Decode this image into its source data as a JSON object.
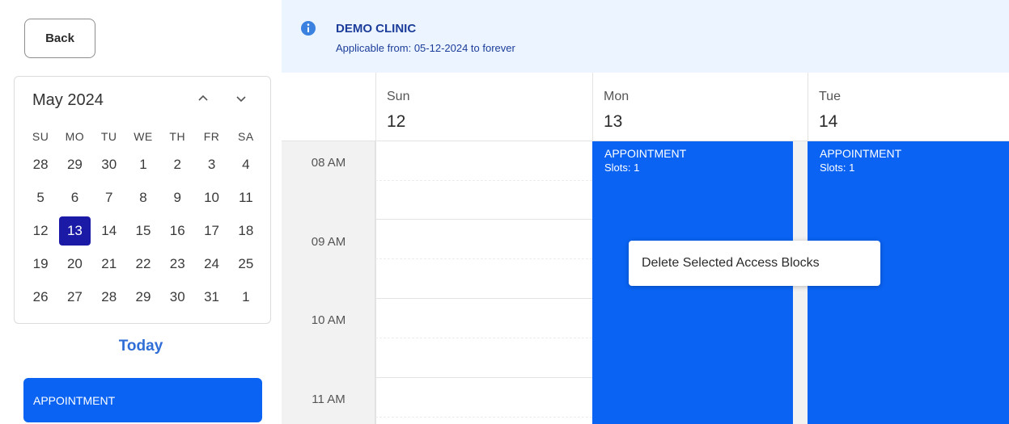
{
  "sidebar": {
    "back_label": "Back",
    "calendar": {
      "month_label": "May 2024",
      "weekday_headers": [
        "SU",
        "MO",
        "TU",
        "WE",
        "TH",
        "FR",
        "SA"
      ],
      "weeks": [
        [
          "28",
          "29",
          "30",
          "1",
          "2",
          "3",
          "4"
        ],
        [
          "5",
          "6",
          "7",
          "8",
          "9",
          "10",
          "11"
        ],
        [
          "12",
          "13",
          "14",
          "15",
          "16",
          "17",
          "18"
        ],
        [
          "19",
          "20",
          "21",
          "22",
          "23",
          "24",
          "25"
        ],
        [
          "26",
          "27",
          "28",
          "29",
          "30",
          "31",
          "1"
        ]
      ],
      "selected_day": "13",
      "prev_icon": "chevron-up-icon",
      "next_icon": "chevron-down-icon"
    },
    "today_label": "Today",
    "appointment_label": "APPOINTMENT"
  },
  "banner": {
    "icon": "info-icon",
    "title": "DEMO CLINIC",
    "subtitle": "Applicable from: 05-12-2024 to forever"
  },
  "schedule": {
    "days": [
      {
        "name": "Sun",
        "number": "12"
      },
      {
        "name": "Mon",
        "number": "13"
      },
      {
        "name": "Tue",
        "number": "14"
      }
    ],
    "times": [
      "08 AM",
      "09 AM",
      "10 AM",
      "11 AM"
    ],
    "appointments": [
      {
        "title": "APPOINTMENT",
        "slots": "Slots: 1"
      },
      {
        "title": "APPOINTMENT",
        "slots": "Slots: 1"
      }
    ]
  },
  "context_menu": {
    "item_label": "Delete Selected Access Blocks"
  },
  "colors": {
    "accent": "#0a63f3",
    "selected_day": "#1a1aa6",
    "banner_bg": "#ebf4ff",
    "banner_text": "#1c3d9a",
    "today_link": "#2f6ed6"
  }
}
